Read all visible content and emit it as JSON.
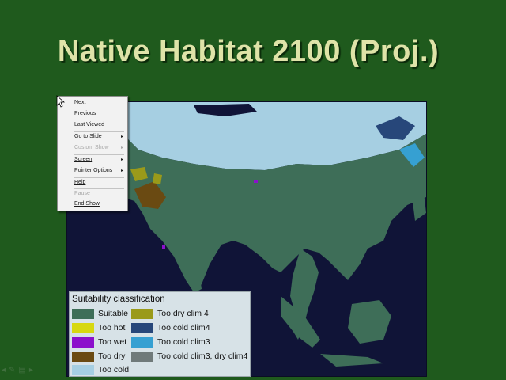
{
  "slide": {
    "title": "Native Habitat 2100 (Proj.)"
  },
  "context_menu": {
    "items": [
      {
        "label": "Next",
        "enabled": true,
        "submenu": false
      },
      {
        "label": "Previous",
        "enabled": true,
        "submenu": false
      },
      {
        "label": "Last Viewed",
        "enabled": true,
        "submenu": false
      },
      {
        "label": "Go to Slide",
        "enabled": true,
        "submenu": true
      },
      {
        "label": "Custom Show",
        "enabled": false,
        "submenu": true
      },
      {
        "label": "Screen",
        "enabled": true,
        "submenu": true
      },
      {
        "label": "Pointer Options",
        "enabled": true,
        "submenu": true
      },
      {
        "label": "Help",
        "enabled": true,
        "submenu": false
      },
      {
        "label": "Pause",
        "enabled": false,
        "submenu": false
      },
      {
        "label": "End Show",
        "enabled": true,
        "submenu": false
      }
    ],
    "submenu_glyph": "▸"
  },
  "legend": {
    "title": "Suitability classification",
    "items": [
      {
        "label": "Suitable",
        "color": "#3e6e58"
      },
      {
        "label": "Too hot",
        "color": "#d7d810"
      },
      {
        "label": "Too wet",
        "color": "#8c10cc"
      },
      {
        "label": "Too dry",
        "color": "#6a4a12"
      },
      {
        "label": "Too cold",
        "color": "#a6cfe2"
      },
      {
        "label": "Too dry clim 4",
        "color": "#9a9a1a"
      },
      {
        "label": "Too cold clim4",
        "color": "#27477a"
      },
      {
        "label": "Too cold clim3",
        "color": "#36a0d2"
      },
      {
        "label": "Too cold clim3, dry clim4",
        "color": "#707a7a"
      }
    ]
  },
  "colors": {
    "background": "#1f5a1d",
    "ocean": "#101437",
    "title": "#dfe3a8"
  },
  "icons": {
    "pointer": "mouse-pointer-icon",
    "toolbar": [
      "arrow-icon",
      "pen-icon",
      "slides-icon",
      "menu-icon"
    ]
  },
  "toolbar_glyphs": [
    "◂",
    "✎",
    "▤",
    "▸"
  ]
}
